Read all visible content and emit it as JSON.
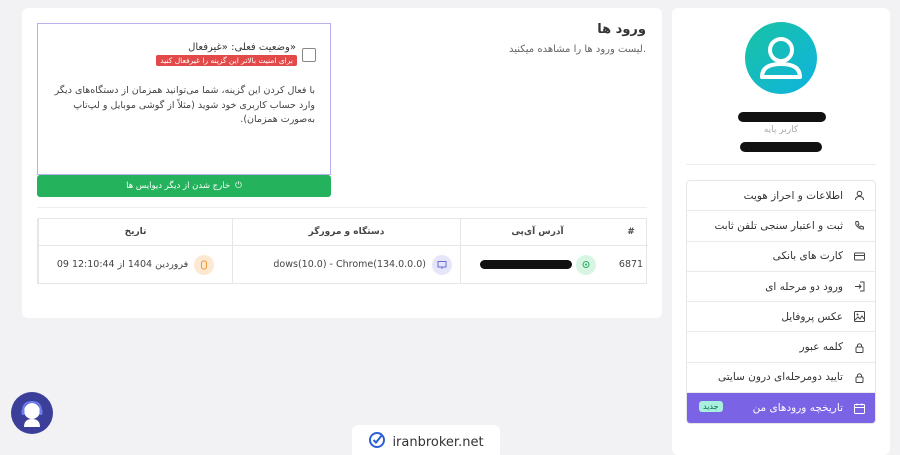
{
  "sidebar": {
    "role": "کاربر پایه",
    "menu": [
      {
        "label": "اطلاعات و احراز هویت",
        "icon": "user-icon"
      },
      {
        "label": "ثبت و اعتبار سنجی تلفن ثابت",
        "icon": "phone-icon"
      },
      {
        "label": "کارت های بانکی",
        "icon": "card-icon"
      },
      {
        "label": "ورود دو مرحله ای",
        "icon": "login-icon"
      },
      {
        "label": "عکس پروفایل",
        "icon": "image-icon"
      },
      {
        "label": "کلمه عبور",
        "icon": "lock-icon"
      },
      {
        "label": "تایید دومرحله‌ای درون سایتی",
        "icon": "lock-icon"
      },
      {
        "label": "تاریخچه ورودهای من",
        "icon": "calendar-icon",
        "active": true,
        "badge": "جدید"
      }
    ]
  },
  "main": {
    "title": "ورود ها",
    "subtitle": "لیست ورود ها را مشاهده میکنید.",
    "status": "وضعیت فعلی: «غیرفعال»",
    "warning": "برای امنیت بالاتر این گزینه را غیرفعال کنید",
    "description": "با فعال کردن این گزینه، شما می‌توانید همزمان از دستگاه‌های دیگر وارد حساب کاربری خود شوید (مثلاً از گوشی موبایل و لپ‌تاپ به‌صورت همزمان).",
    "logout_button": "خارج شدن از دیگر دیوایس ها",
    "table": {
      "headers": {
        "num": "#",
        "ip": "آدرس آی‌پی",
        "device": "دستگاه و مرورگر",
        "date": "تاریخ"
      },
      "rows": [
        {
          "num": "6871",
          "device": "dows(10.0) - Chrome(134.0.0.0)",
          "date": "09 فروردین 1404 از 12:10:44"
        }
      ]
    }
  },
  "footer": {
    "site": "iranbroker.net"
  },
  "colors": {
    "accent": "#7b63e6",
    "green": "#24b35c",
    "red": "#e24a4a"
  }
}
